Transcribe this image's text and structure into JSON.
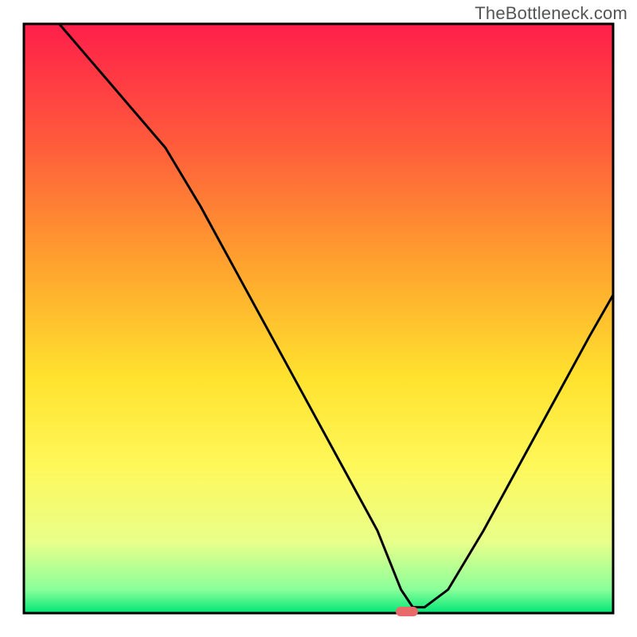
{
  "watermark": "TheBottleneck.com",
  "chart_data": {
    "type": "line",
    "title": "",
    "xlabel": "",
    "ylabel": "",
    "xlim": [
      0,
      100
    ],
    "ylim": [
      0,
      100
    ],
    "grid": false,
    "series": [
      {
        "name": "bottleneck-curve",
        "x": [
          6,
          12,
          18,
          24,
          30,
          36,
          42,
          48,
          54,
          60,
          62,
          64,
          66,
          68,
          72,
          78,
          84,
          90,
          96,
          100
        ],
        "y": [
          100,
          93,
          86,
          79,
          69,
          58,
          47,
          36,
          25,
          14,
          9,
          4,
          1,
          1,
          4,
          14,
          25,
          36,
          47,
          54
        ]
      }
    ],
    "marker": {
      "name": "optimal-point",
      "x": 65,
      "y": 0,
      "color": "#e86a6a"
    },
    "gradient_stops": [
      {
        "offset": 0,
        "color": "#ff1f4a"
      },
      {
        "offset": 20,
        "color": "#ff5a3c"
      },
      {
        "offset": 40,
        "color": "#ffa02e"
      },
      {
        "offset": 60,
        "color": "#ffe22e"
      },
      {
        "offset": 75,
        "color": "#fff85a"
      },
      {
        "offset": 88,
        "color": "#e8ff8a"
      },
      {
        "offset": 96,
        "color": "#8aff9a"
      },
      {
        "offset": 100,
        "color": "#00e676"
      }
    ],
    "frame_color": "#000000",
    "line_color": "#000000"
  }
}
